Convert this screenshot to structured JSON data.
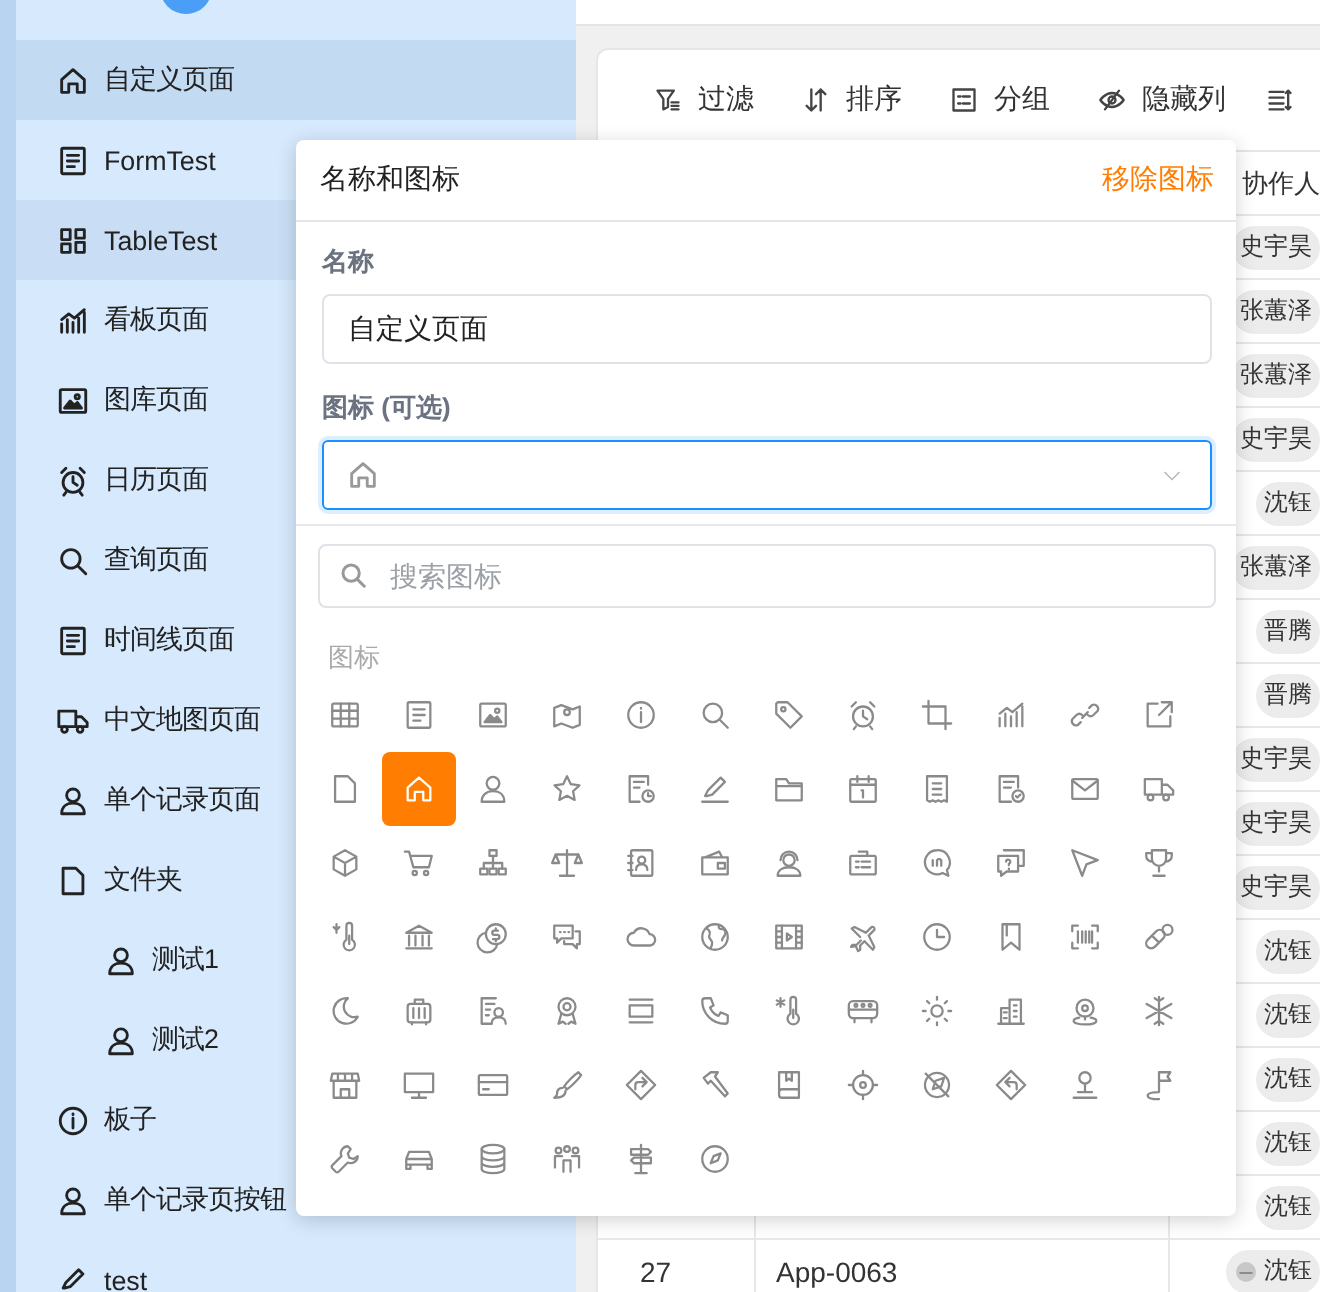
{
  "sidebar": {
    "items": [
      {
        "label": "自定义页面",
        "selected": true,
        "hovered": false
      },
      {
        "label": "FormTest",
        "selected": false,
        "hovered": false
      },
      {
        "label": "TableTest",
        "selected": false,
        "hovered": true
      },
      {
        "label": "看板页面",
        "selected": false,
        "hovered": false
      },
      {
        "label": "图库页面",
        "selected": false,
        "hovered": false
      },
      {
        "label": "日历页面",
        "selected": false,
        "hovered": false
      },
      {
        "label": "查询页面",
        "selected": false,
        "hovered": false
      },
      {
        "label": "时间线页面",
        "selected": false,
        "hovered": false
      },
      {
        "label": "中文地图页面",
        "selected": false,
        "hovered": false
      },
      {
        "label": "单个记录页面",
        "selected": false,
        "hovered": false
      },
      {
        "label": "文件夹",
        "selected": false,
        "hovered": false,
        "children": [
          {
            "label": "测试1",
            "selected": false,
            "hovered": false
          },
          {
            "label": "测试2",
            "selected": false,
            "hovered": false
          }
        ]
      },
      {
        "label": "板子",
        "selected": false,
        "hovered": false
      },
      {
        "label": "单个记录页按钮",
        "selected": false,
        "hovered": false
      },
      {
        "label": "test",
        "selected": false,
        "hovered": false
      }
    ]
  },
  "toolbar": {
    "buttons": [
      {
        "label": "过滤"
      },
      {
        "label": "排序"
      },
      {
        "label": "分组"
      },
      {
        "label": "隐藏列"
      }
    ]
  },
  "table": {
    "columns": [
      "协作人"
    ],
    "rows": [
      {
        "collaborator": "史宇昊"
      },
      {
        "collaborator": "张蕙泽"
      },
      {
        "collaborator": "张蕙泽"
      },
      {
        "collaborator": "史宇昊"
      },
      {
        "collaborator": "沈钰"
      },
      {
        "collaborator": "张蕙泽"
      },
      {
        "collaborator": "晋腾"
      },
      {
        "collaborator": "晋腾"
      },
      {
        "collaborator": "史宇昊"
      },
      {
        "collaborator": "史宇昊"
      },
      {
        "collaborator": "史宇昊"
      },
      {
        "collaborator": "沈钰"
      },
      {
        "collaborator": "沈钰"
      },
      {
        "collaborator": "沈钰"
      },
      {
        "collaborator": "沈钰"
      },
      {
        "collaborator": "沈钰"
      },
      {
        "cells": [
          "27",
          "App-0063"
        ],
        "collaborator": "沈钰",
        "avatar": true
      }
    ]
  },
  "popup": {
    "title": "名称和图标",
    "remove_link": "移除图标",
    "name_label": "名称",
    "name_value": "自定义页面",
    "icon_label": "图标 (可选)",
    "search_placeholder": "搜索图标",
    "group_label": "图标",
    "icons": [
      {
        "selected": false
      },
      {
        "selected": false
      },
      {
        "selected": false
      },
      {
        "selected": false
      },
      {
        "selected": false
      },
      {
        "selected": false
      },
      {
        "selected": false
      },
      {
        "selected": false
      },
      {
        "selected": false
      },
      {
        "selected": false
      },
      {
        "selected": false
      },
      {
        "selected": false
      },
      {
        "selected": false
      },
      {
        "selected": true
      },
      {
        "selected": false
      },
      {
        "selected": false
      },
      {
        "selected": false
      },
      {
        "selected": false
      },
      {
        "selected": false
      },
      {
        "selected": false
      },
      {
        "selected": false
      },
      {
        "selected": false
      },
      {
        "selected": false
      },
      {
        "selected": false
      },
      {
        "selected": false
      },
      {
        "selected": false
      },
      {
        "selected": false
      },
      {
        "selected": false
      },
      {
        "selected": false
      },
      {
        "selected": false
      },
      {
        "selected": false
      },
      {
        "selected": false
      },
      {
        "selected": false
      },
      {
        "selected": false
      },
      {
        "selected": false
      },
      {
        "selected": false
      },
      {
        "selected": false
      },
      {
        "selected": false
      },
      {
        "selected": false
      },
      {
        "selected": false
      },
      {
        "selected": false
      },
      {
        "selected": false
      },
      {
        "selected": false
      },
      {
        "selected": false
      },
      {
        "selected": false
      },
      {
        "selected": false
      },
      {
        "selected": false
      },
      {
        "selected": false
      },
      {
        "selected": false
      },
      {
        "selected": false
      },
      {
        "selected": false
      },
      {
        "selected": false
      },
      {
        "selected": false
      },
      {
        "selected": false
      },
      {
        "selected": false
      },
      {
        "selected": false
      },
      {
        "selected": false
      },
      {
        "selected": false
      },
      {
        "selected": false
      },
      {
        "selected": false
      },
      {
        "selected": false
      },
      {
        "selected": false
      },
      {
        "selected": false
      },
      {
        "selected": false
      },
      {
        "selected": false
      },
      {
        "selected": false
      },
      {
        "selected": false
      },
      {
        "selected": false
      },
      {
        "selected": false
      },
      {
        "selected": false
      },
      {
        "selected": false
      },
      {
        "selected": false
      },
      {
        "selected": false
      },
      {
        "selected": false
      },
      {
        "selected": false
      },
      {
        "selected": false
      },
      {
        "selected": false
      },
      {
        "selected": false
      }
    ]
  }
}
